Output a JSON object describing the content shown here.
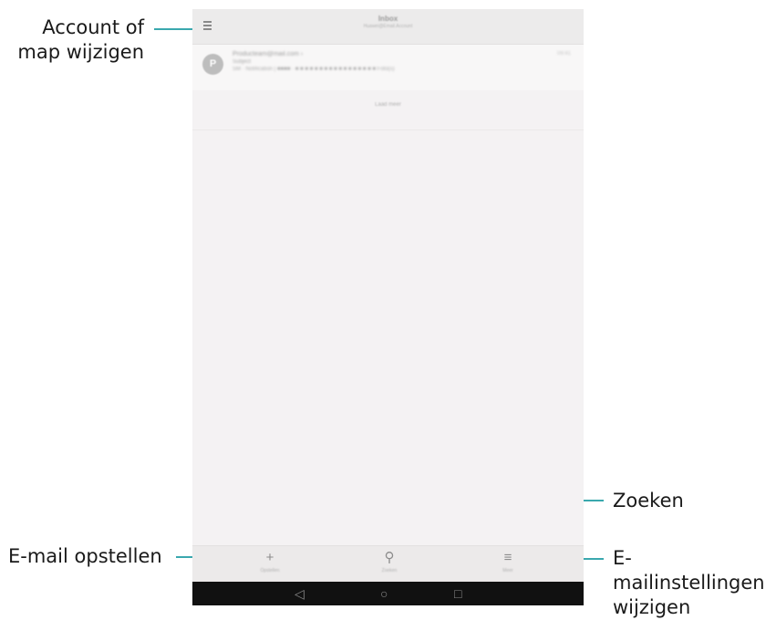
{
  "callouts": {
    "account_line1": "Account of",
    "account_line2": "map wijzigen",
    "search": "Zoeken",
    "compose": "E-mail opstellen",
    "settings_line1": "E-mailinstellingen",
    "settings_line2": "wijzigen"
  },
  "screen": {
    "title": "Inbox",
    "subtitle": "Huawei@Email.Account",
    "message": {
      "avatar_letter": "P",
      "from": "Producteam@mail.com ›",
      "subject": "Subject",
      "preview": "SM · Notification | ■■■■ · ■ ■ ■ ■ ■ ■ ■ ■ ■ ■ ■ ■ ■ ■ ■ ■ ■ Foto(s)",
      "time": "09:41"
    },
    "load_more": "Laad meer",
    "tabs": [
      {
        "icon": "+",
        "label": "Opstellen"
      },
      {
        "icon": "⚲",
        "label": "Zoeken"
      },
      {
        "icon": "≡",
        "label": "Meer"
      }
    ],
    "nav": {
      "back": "◁",
      "home": "○",
      "recent": "□"
    }
  },
  "colors": {
    "accent": "#3aa8ae",
    "screen_bg": "#f4f2f3",
    "navbar_bg": "#111111"
  }
}
